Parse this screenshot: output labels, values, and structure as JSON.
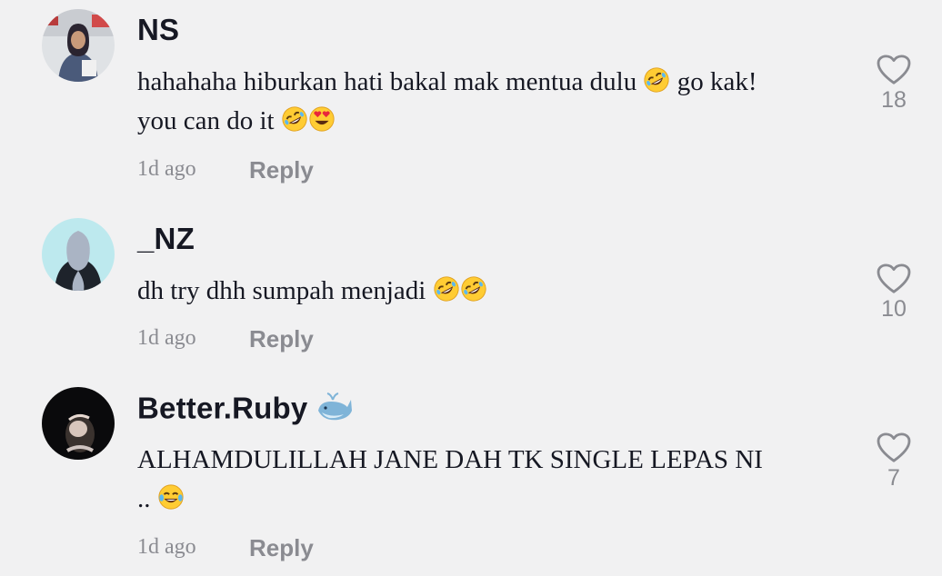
{
  "comments": [
    {
      "username": "NS",
      "text_1": "hahahaha hiburkan hati bakal mak mentua dulu ",
      "text_2": " go kak!",
      "text_3": "you can do it ",
      "time": "1d ago",
      "reply_label": "Reply",
      "likes": "18"
    },
    {
      "username": "_NZ",
      "text_1": "dh try dhh sumpah menjadi ",
      "time": "1d ago",
      "reply_label": "Reply",
      "likes": "10"
    },
    {
      "username": "Better.Ruby",
      "badge_icon": "whale-icon",
      "text_1": "ALHAMDULILLAH JANE DAH TK SINGLE LEPAS NI",
      "text_2": ".. ",
      "time": "1d ago",
      "reply_label": "Reply",
      "likes": "7"
    }
  ],
  "colors": {
    "background": "#f1f1f2",
    "username": "#161823",
    "secondary": "#8a8b91"
  }
}
